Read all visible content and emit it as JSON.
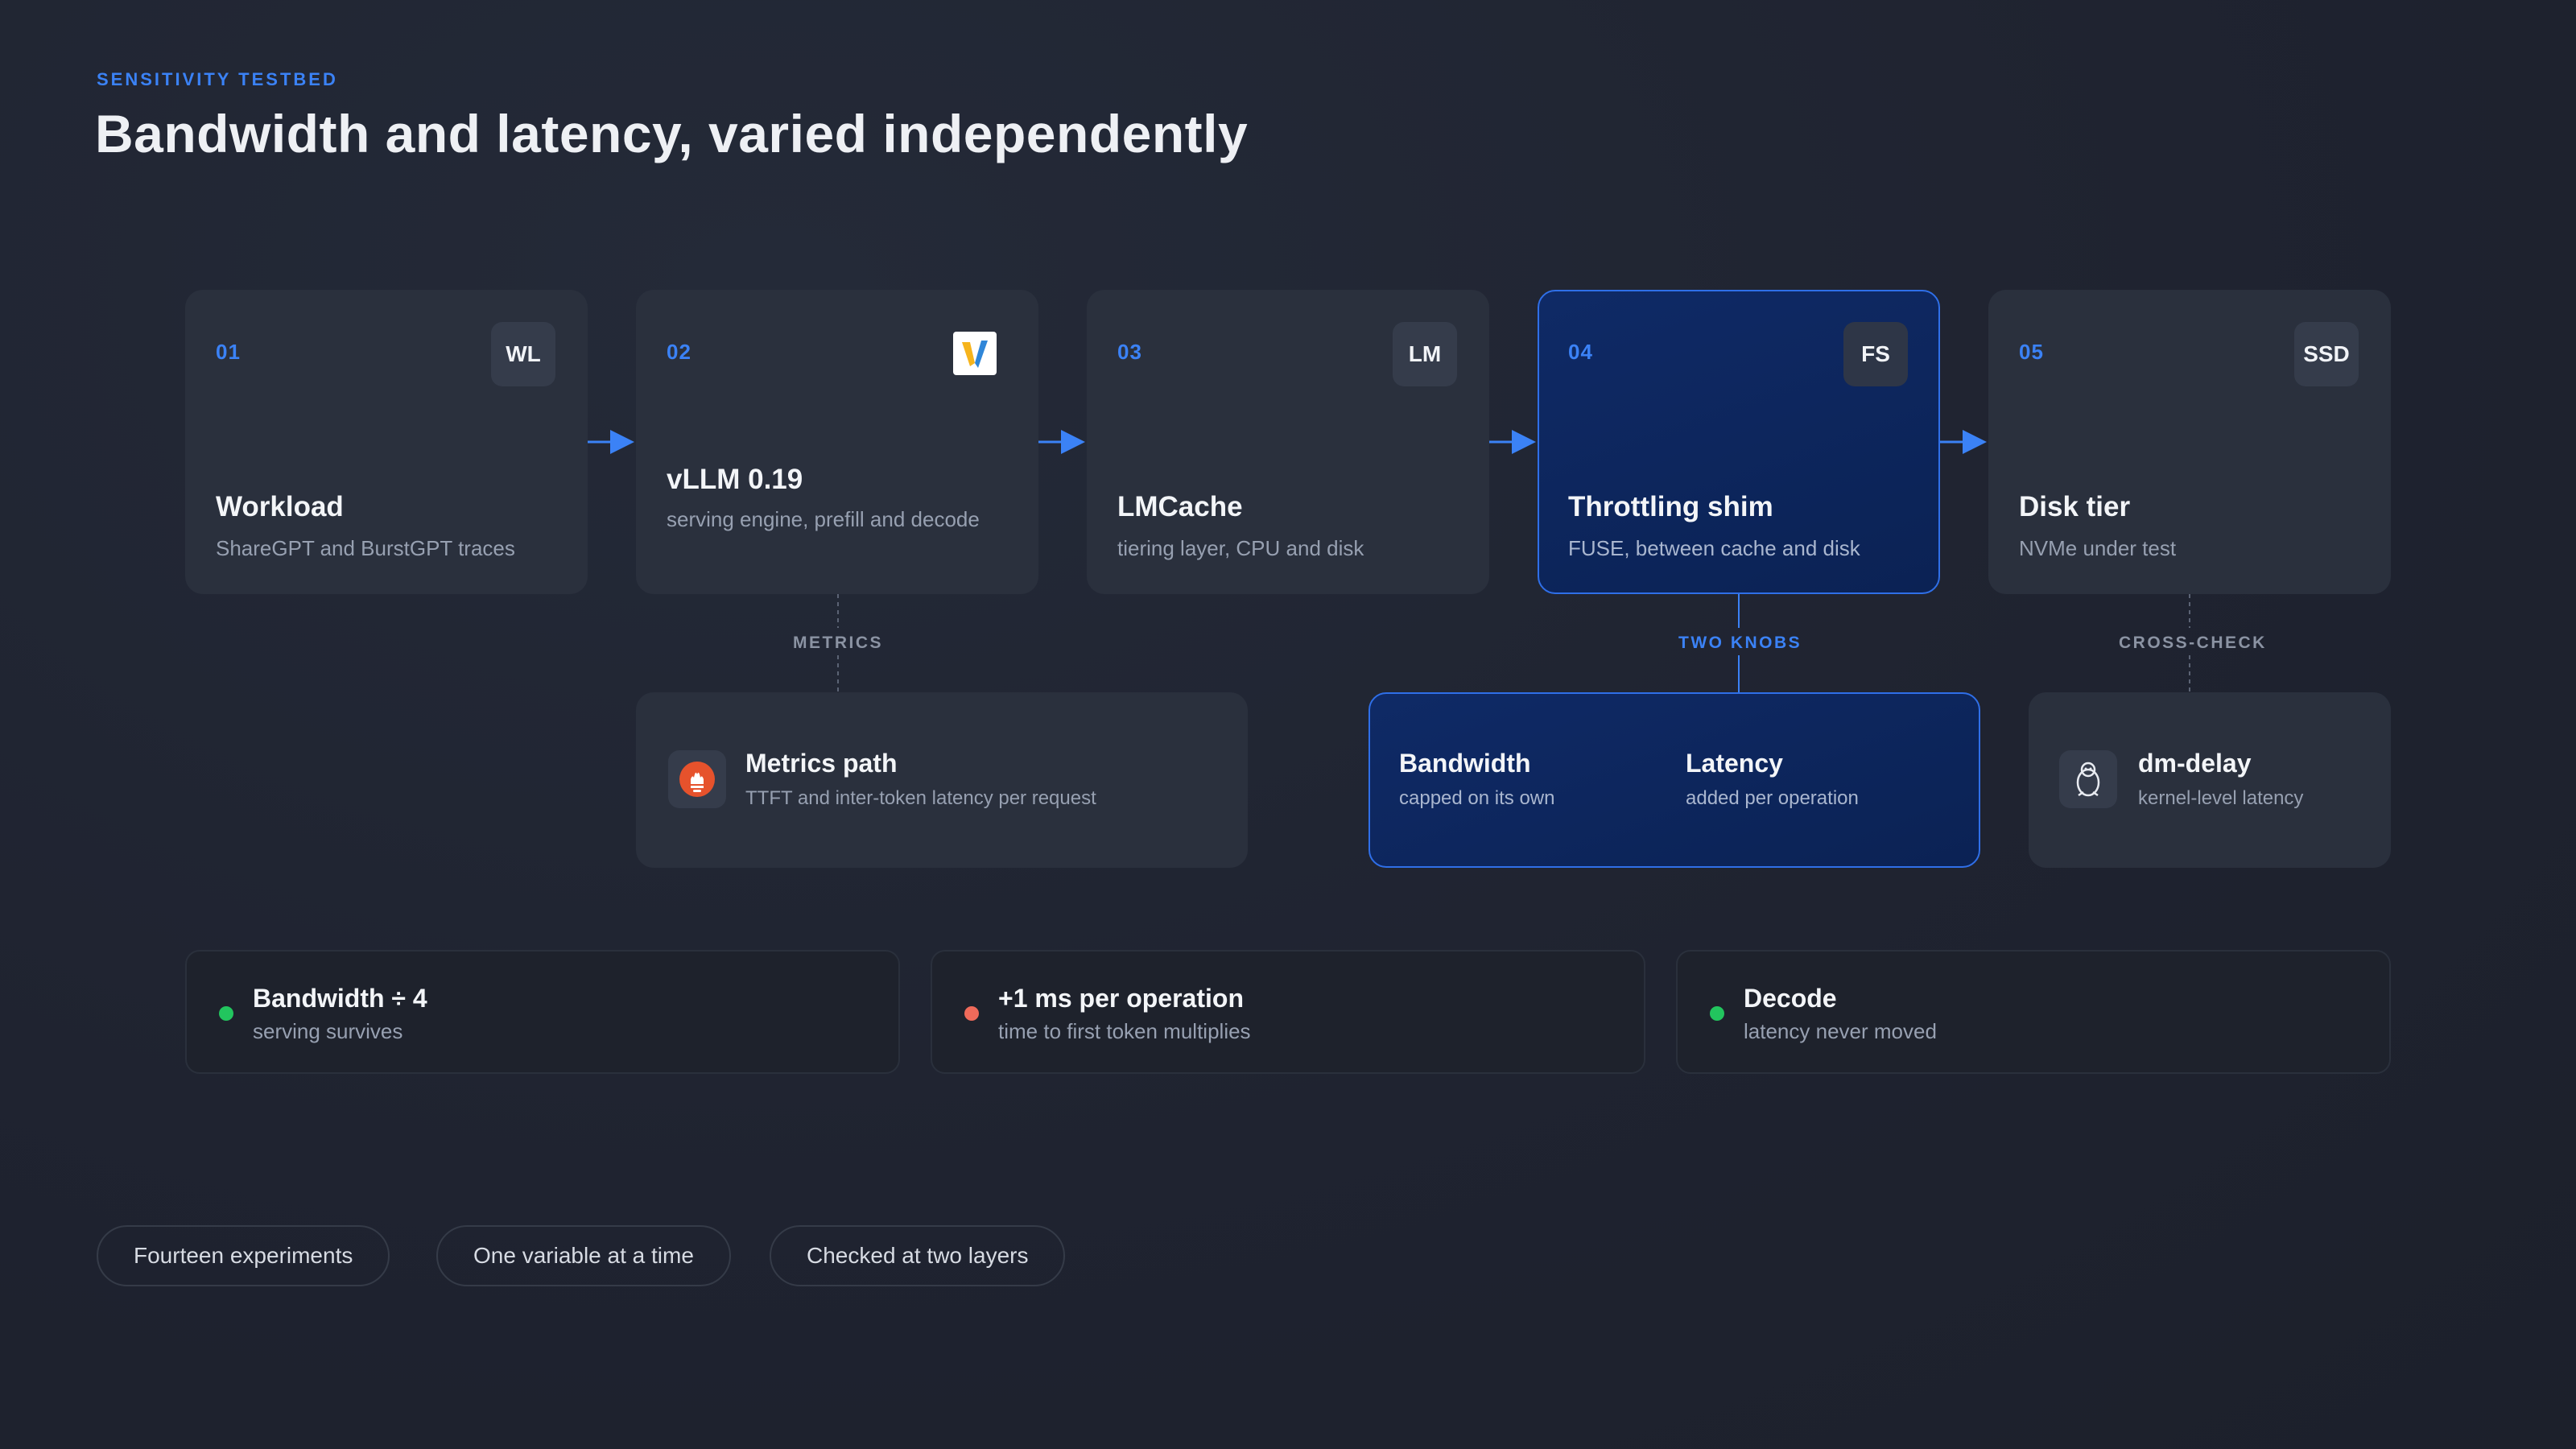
{
  "header": {
    "eyebrow": "SENSITIVITY TESTBED",
    "title": "Bandwidth and latency, varied independently"
  },
  "stages": [
    {
      "num": "01",
      "badge": "WL",
      "title": "Workload",
      "subtitle": "ShareGPT and BurstGPT traces"
    },
    {
      "num": "02",
      "badge_icon": "vllm-logo-icon",
      "title": "vLLM 0.19",
      "subtitle": "serving engine, prefill and decode"
    },
    {
      "num": "03",
      "badge": "LM",
      "title": "LMCache",
      "subtitle": "tiering layer, CPU and disk"
    },
    {
      "num": "04",
      "badge": "FS",
      "title": "Throttling shim",
      "subtitle": "FUSE, between cache and disk"
    },
    {
      "num": "05",
      "badge": "SSD",
      "title": "Disk tier",
      "subtitle": "NVMe under test"
    }
  ],
  "connectors": {
    "metrics": "METRICS",
    "two_knobs": "TWO KNOBS",
    "cross_check": "CROSS-CHECK"
  },
  "panels": {
    "metrics": {
      "icon": "prometheus-icon",
      "title": "Metrics path",
      "subtitle": "TTFT and inter-token latency per request"
    },
    "knobs": {
      "bandwidth": {
        "title": "Bandwidth",
        "subtitle": "capped on its own"
      },
      "latency": {
        "title": "Latency",
        "subtitle": "added per operation"
      }
    },
    "dmdelay": {
      "icon": "linux-tux-icon",
      "title": "dm-delay",
      "subtitle": "kernel-level latency"
    }
  },
  "results": [
    {
      "title": "Bandwidth ÷ 4",
      "subtitle": "serving survives",
      "color": "#22c55e"
    },
    {
      "title": "+1 ms per operation",
      "subtitle": "time to first token multiplies",
      "color": "#ef6a5a"
    },
    {
      "title": "Decode",
      "subtitle": "latency never moved",
      "color": "#22c55e"
    }
  ],
  "pills": [
    "Fourteen experiments",
    "One variable at a time",
    "Checked at two layers"
  ],
  "colors": {
    "accent": "#3b82f6",
    "card": "#2a303d",
    "active": "#0f2a66",
    "good": "#22c55e",
    "bad": "#ef6a5a"
  }
}
